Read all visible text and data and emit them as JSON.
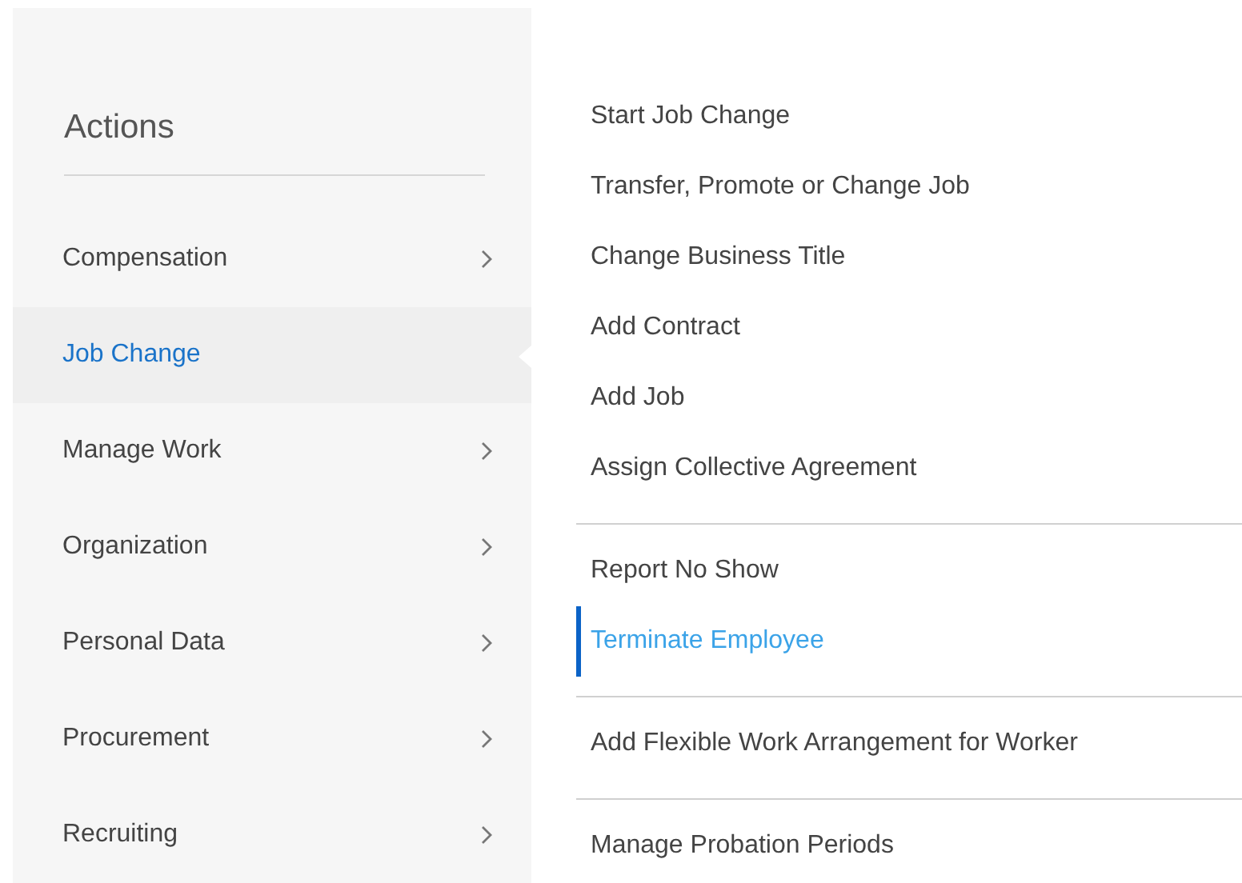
{
  "sidebar": {
    "title": "Actions",
    "items": [
      {
        "label": "Compensation",
        "selected": false
      },
      {
        "label": "Job Change",
        "selected": true
      },
      {
        "label": "Manage Work",
        "selected": false
      },
      {
        "label": "Organization",
        "selected": false
      },
      {
        "label": "Personal Data",
        "selected": false
      },
      {
        "label": "Procurement",
        "selected": false
      },
      {
        "label": "Recruiting",
        "selected": false
      }
    ]
  },
  "submenu": {
    "groups": [
      [
        {
          "label": "Start Job Change",
          "selected": false
        },
        {
          "label": "Transfer, Promote or Change Job",
          "selected": false
        },
        {
          "label": "Change Business Title",
          "selected": false
        },
        {
          "label": "Add Contract",
          "selected": false
        },
        {
          "label": "Add Job",
          "selected": false
        },
        {
          "label": "Assign Collective Agreement",
          "selected": false
        }
      ],
      [
        {
          "label": "Report No Show",
          "selected": false
        },
        {
          "label": "Terminate Employee",
          "selected": true
        }
      ],
      [
        {
          "label": "Add Flexible Work Arrangement for Worker",
          "selected": false
        }
      ],
      [
        {
          "label": "Manage Probation Periods",
          "selected": false
        }
      ]
    ]
  }
}
